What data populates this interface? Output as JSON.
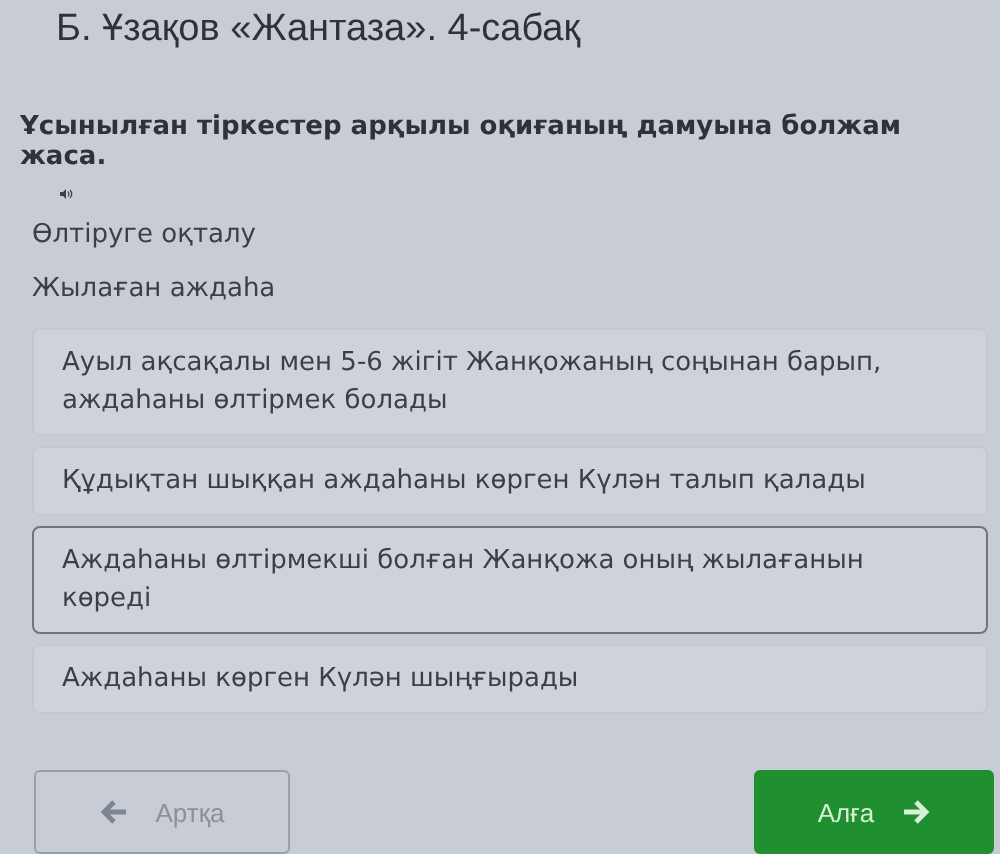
{
  "title": "Б. Ұзақов «Жантаза». 4-сабақ",
  "instruction": "Ұсынылған тіркестер арқылы оқиғаның дамуына болжам жаса.",
  "phrases": [
    "Өлтіруге оқталу",
    "Жылаған аждаһа"
  ],
  "options": [
    {
      "text": "Ауыл ақсақалы мен 5-6 жігіт Жанқожаның соңынан барып, аждаһаны өлтірмек болады",
      "selected": false
    },
    {
      "text": "Құдықтан шыққан аждаһаны көрген Күлән талып қалады",
      "selected": false
    },
    {
      "text": "Аждаһаны өлтірмекші болған Жанқожа оның жылағанын көреді",
      "selected": true
    },
    {
      "text": "Аждаһаны көрген Күлән шыңғырады",
      "selected": false
    }
  ],
  "back_button": {
    "label": "Артқа",
    "disabled": true
  },
  "next_button": {
    "label": "Алға",
    "disabled": false
  }
}
